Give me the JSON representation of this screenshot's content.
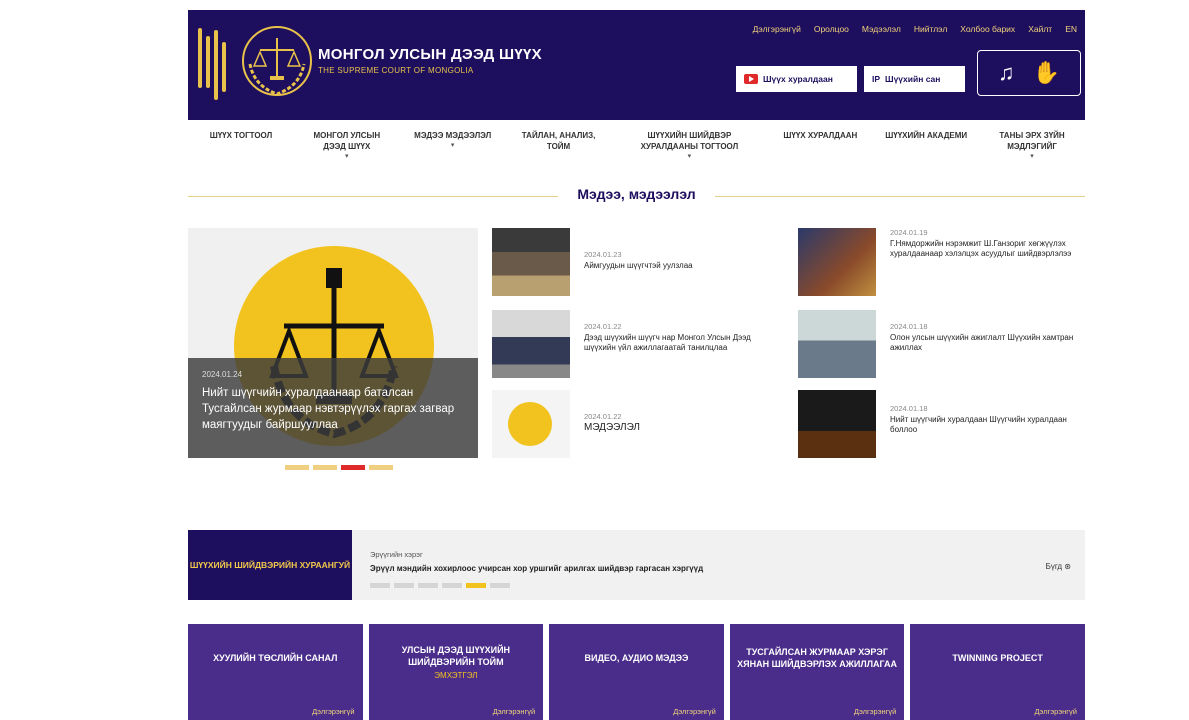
{
  "header": {
    "title": "МОНГОЛ УЛСЫН ДЭЭД ШҮҮХ",
    "subtitle": "THE SUPREME COURT OF MONGOLIA",
    "top_links": [
      "Дэлгэрэнгүй",
      "Оролцоо",
      "Мэдээлэл",
      "Нийтлэл",
      "Холбоо барих",
      "Хайлт",
      "EN"
    ],
    "live_button": "Шүүх хуралдаан",
    "ip_button": "Шүүхийн сан"
  },
  "nav": [
    {
      "label": "ШҮҮХ ТОГТООЛ",
      "has_menu": false
    },
    {
      "label": "МОНГОЛ УЛСЫН ДЭЭД ШҮҮХ",
      "has_menu": true
    },
    {
      "label": "МЭДЭЭ МЭДЭЭЛЭЛ",
      "has_menu": true
    },
    {
      "label": "ТАЙЛАН, АНАЛИЗ, ТОЙМ",
      "has_menu": false
    },
    {
      "label": "ШҮҮХИЙН ШИЙДВЭР ХУРАЛДААНЫ ТОГТООЛ",
      "has_menu": true
    },
    {
      "label": "ШҮҮХ ХУРАЛДААН",
      "has_menu": false
    },
    {
      "label": "ШҮҮХИЙН АКАДЕМИ",
      "has_menu": false
    },
    {
      "label": "ТАНЫ ЭРХ ЗҮЙН МЭДЛЭГИЙГ",
      "has_menu": true
    }
  ],
  "section_title": "Мэдээ, мэдээлэл",
  "featured": {
    "date": "2024.01.24",
    "headline": "Нийт шүүгчийн хуралдаанаар баталсан Тусгайлсан журмаар нэвтэрүүлэх гаргах загвар маягтуудыг байршууллаа",
    "dots": [
      false,
      false,
      true,
      false
    ]
  },
  "news_left": [
    {
      "date": "2024.01.23",
      "title": "Аймгуудын шүүгчтэй уулзлаа"
    },
    {
      "date": "2024.01.22",
      "title": "Дээд шүүхийн шүүгч нар Монгол Улсын Дээд шүүхийн үйл ажиллагаатай танилцлаа"
    },
    {
      "date": "2024.01.22",
      "title": "МЭДЭЭЛЭЛ"
    }
  ],
  "news_right": [
    {
      "date": "2024.01.19",
      "title": "Г.Нямдоржийн нэрэмжит Ш.Ганзориг хөгжүүлэх хуралдаанаар хэлэлцэх асуудлыг шийдвэрлэлээ"
    },
    {
      "date": "2024.01.18",
      "title": "Олон улсын шүүхийн ажиглалт Шүүхийн хамтран ажиллах"
    },
    {
      "date": "2024.01.18",
      "title": "Нийт шүүгчийн хуралдаан Шүүгчийн хуралдаан боллоо"
    }
  ],
  "calendar": {
    "label": "ШҮҮХИЙН ШИЙДВЭРИЙН ХУРААНГУЙ",
    "date_line": "Эрүүгийн хэрэг",
    "headline": "Эрүүл мэндийн хохирлоос учирсан хор уршгийг арилгах шийдвэр гаргасан хэргүүд",
    "more": "Бүгд",
    "dots": [
      false,
      false,
      false,
      false,
      true,
      false
    ]
  },
  "cards": [
    {
      "title": "ХУУЛИЙН ТӨСЛИЙН САНАЛ",
      "sub": "",
      "more": "Дэлгэрэнгүй"
    },
    {
      "title": "УЛСЫН ДЭЭД ШҮҮХИЙН ШИЙДВЭРИЙН ТОЙМ",
      "sub": "Эмхэтгэл",
      "more": "Дэлгэрэнгүй"
    },
    {
      "title": "ВИДЕО, АУДИО МЭДЭЭ",
      "sub": "",
      "more": "Дэлгэрэнгүй"
    },
    {
      "title": "ТУСГАЙЛСАН ЖУРМААР ХЭРЭГ ХЯНАН ШИЙДВЭРЛЭХ АЖИЛЛАГАА",
      "sub": "",
      "more": "Дэлгэрэнгүй"
    },
    {
      "title": "TWINNING PROJECT",
      "sub": "",
      "more": "Дэлгэрэнгүй"
    }
  ],
  "colors": {
    "primary": "#1e0e5e",
    "gold": "#f2c31f",
    "accent_red": "#e02a2a",
    "card": "#4a2d8a"
  }
}
